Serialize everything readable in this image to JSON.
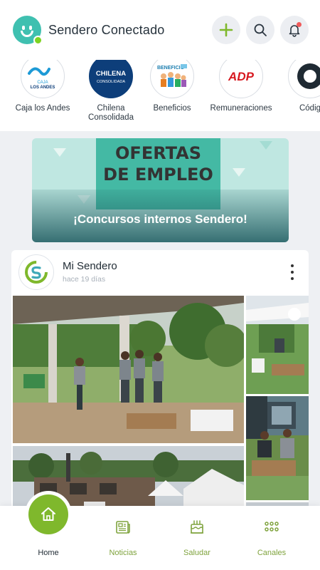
{
  "header": {
    "app_title": "Sendero Conectado",
    "logo_icon": "smiley-logo-icon",
    "actions": [
      {
        "name": "add-icon",
        "color": "#7fb82c"
      },
      {
        "name": "search-icon"
      },
      {
        "name": "bell-icon",
        "notification": true
      }
    ]
  },
  "shortcuts": [
    {
      "label": "Caja los Andes",
      "logo_text_1": "CAJA",
      "logo_text_2": "LOS ANDES",
      "color": "#1d9ad6"
    },
    {
      "label": "Chilena Consolidada",
      "logo_text_1": "CHILENA",
      "logo_text_2": "CONSOLIDADA",
      "color": "#0d3e7a"
    },
    {
      "label": "Beneficios",
      "logo_text_1": "BENEFICIO",
      "logo_text_2": ""
    },
    {
      "label": "Remuneraciones",
      "logo_text_1": "ADP",
      "logo_text_2": "",
      "color": "#d71920"
    },
    {
      "label": "Códig",
      "logo_text_1": "",
      "logo_text_2": ""
    }
  ],
  "banner": {
    "sign_line_1": "OFERTAS",
    "sign_line_2": "DE EMPLEO",
    "caption": "¡Concursos internos Sendero!"
  },
  "post": {
    "author": "Mi Sendero",
    "time": "hace 19 días",
    "menu_icon": "more-vertical-icon",
    "photo_count": 5
  },
  "bottom_nav": {
    "items": [
      {
        "label": "Home",
        "icon": "home-icon",
        "active": true
      },
      {
        "label": "Noticias",
        "icon": "newspaper-icon",
        "active": false
      },
      {
        "label": "Saludar",
        "icon": "cake-icon",
        "active": false
      },
      {
        "label": "Canales",
        "icon": "grid-icon",
        "active": false
      }
    ],
    "accent_color": "#7fb82c"
  }
}
